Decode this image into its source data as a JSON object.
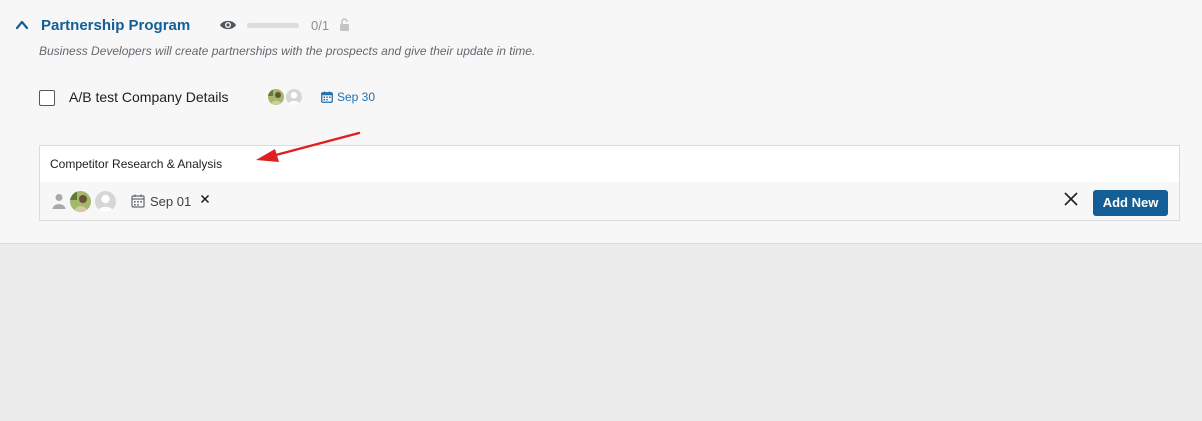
{
  "milestone": {
    "title": "Partnership Program",
    "progress_text": "0/1",
    "progress_fraction": 0,
    "description": "Business Developers will create partnerships with the prospects and give their update in time."
  },
  "task": {
    "title": "A/B test Company Details",
    "due_date": "Sep 30",
    "assignee_icons": [
      "avatar-photo",
      "avatar-placeholder"
    ]
  },
  "new_task_form": {
    "input_value": "Competitor Research & Analysis",
    "due_date": "Sep 01",
    "add_button_label": "Add New",
    "icons": [
      "person-icon",
      "calendar-icon",
      "close-icon"
    ]
  },
  "colors": {
    "accent": "#135e96",
    "link": "#2271b1",
    "annotation_arrow": "#e02020"
  }
}
